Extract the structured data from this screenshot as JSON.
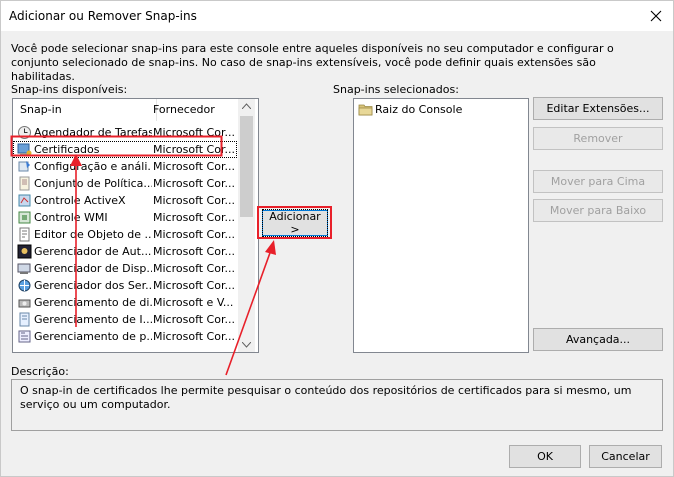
{
  "window": {
    "title": "Adicionar ou Remover Snap-ins",
    "intro": "Você pode selecionar snap-ins para este console entre aqueles disponíveis no seu computador e configurar o conjunto selecionado de snap-ins. No caso de snap-ins extensíveis, você pode definir quais extensões são habilitadas."
  },
  "available": {
    "label": "Snap-ins disponíveis:",
    "columns": [
      "Snap-in",
      "Fornecedor"
    ],
    "items": [
      {
        "name": "Agendador de Tarefas",
        "vendor": "Microsoft Cor..."
      },
      {
        "name": "Certificados",
        "vendor": "Microsoft Cor..."
      },
      {
        "name": "Configuração e análi...",
        "vendor": "Microsoft Cor..."
      },
      {
        "name": "Conjunto de Política...",
        "vendor": "Microsoft Cor..."
      },
      {
        "name": "Controle ActiveX",
        "vendor": "Microsoft Cor..."
      },
      {
        "name": "Controle WMI",
        "vendor": "Microsoft Cor..."
      },
      {
        "name": "Editor de Objeto de ...",
        "vendor": "Microsoft Cor..."
      },
      {
        "name": "Gerenciador de Aut...",
        "vendor": "Microsoft Cor..."
      },
      {
        "name": "Gerenciador de Disp...",
        "vendor": "Microsoft Cor..."
      },
      {
        "name": "Gerenciador dos Ser...",
        "vendor": "Microsoft Cor..."
      },
      {
        "name": "Gerenciamento de di...",
        "vendor": "Microsoft e V..."
      },
      {
        "name": "Gerenciamento de I...",
        "vendor": "Microsoft Cor..."
      },
      {
        "name": "Gerenciamento de p...",
        "vendor": "Microsoft Cor..."
      }
    ]
  },
  "add_button": "Adicionar >",
  "selected": {
    "label": "Snap-ins selecionados:",
    "items": [
      {
        "name": "Raiz do Console"
      }
    ]
  },
  "buttons": {
    "edit_extensions": "Editar Extensões...",
    "remove": "Remover",
    "move_up": "Mover para Cima",
    "move_down": "Mover para Baixo",
    "advanced": "Avançada...",
    "ok": "OK",
    "cancel": "Cancelar"
  },
  "description": {
    "label": "Descrição:",
    "text": "O snap-in de certificados lhe permite pesquisar o conteúdo dos repositórios de certificados para si mesmo, um serviço ou um computador."
  },
  "colors": {
    "annotation": "#e8202a",
    "selection_focus": "#0078d7"
  }
}
